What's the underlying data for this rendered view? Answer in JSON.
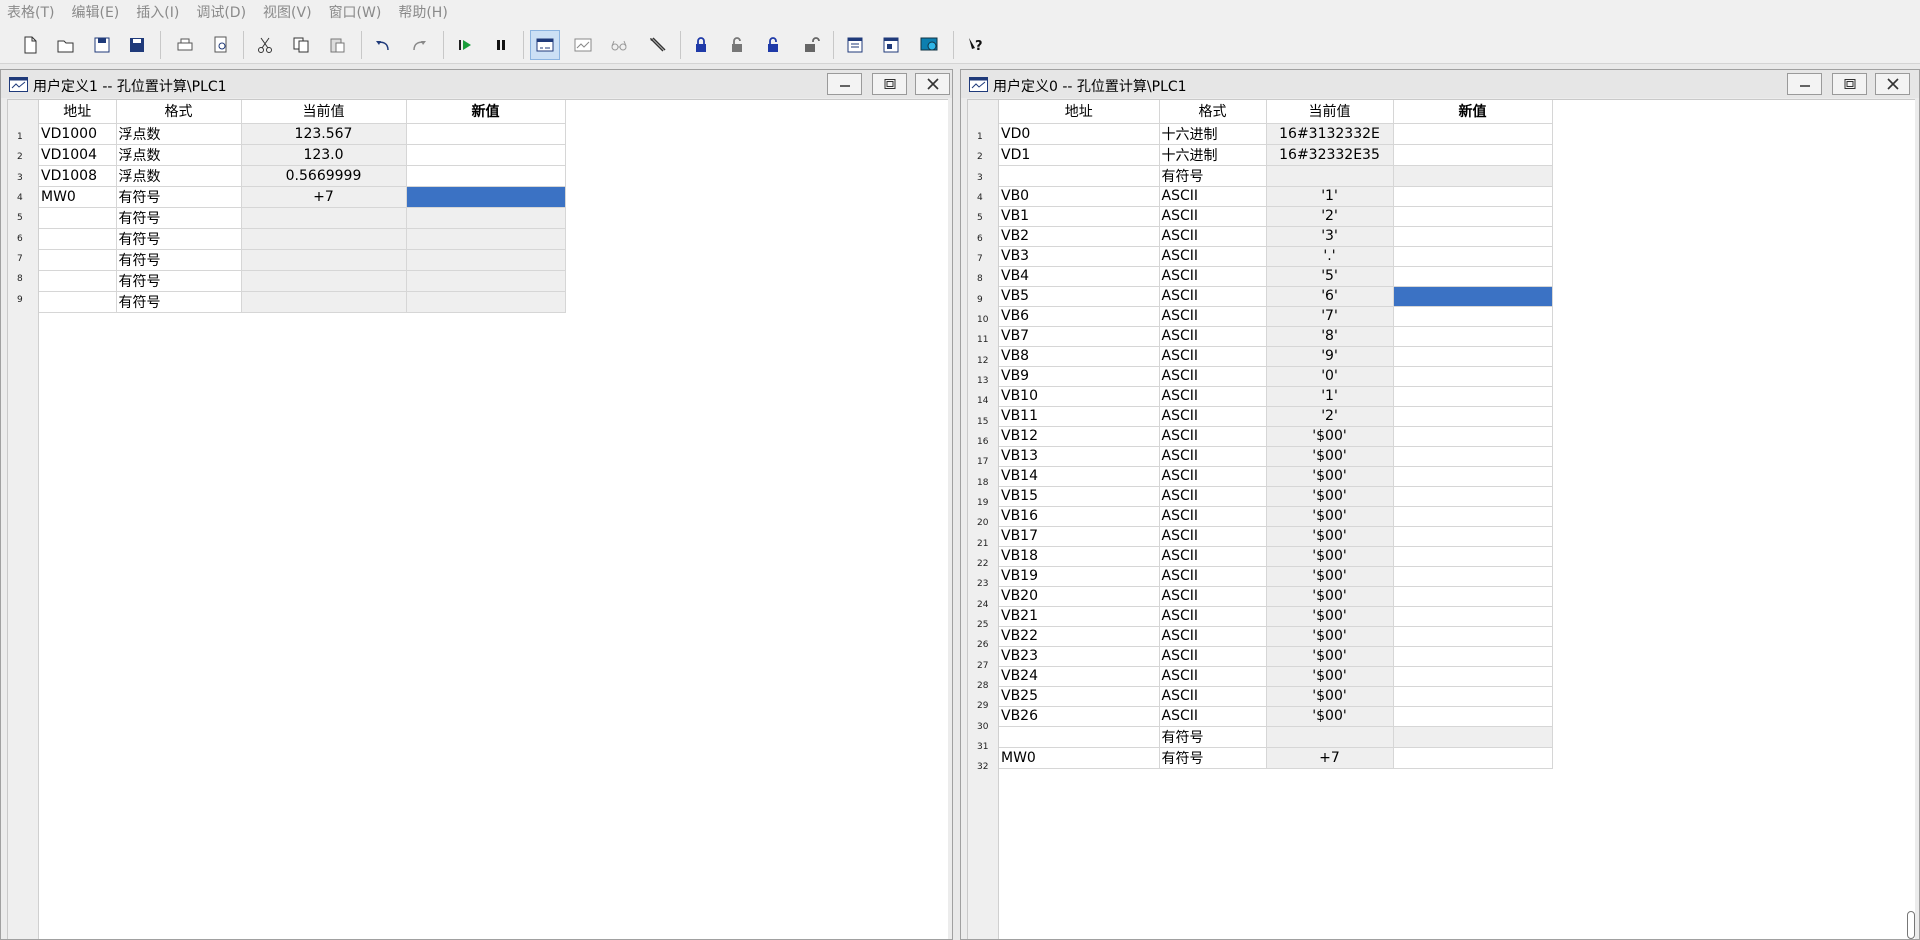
{
  "menu": [
    "表格(T)",
    "编辑(E)",
    "插入(I)",
    "调试(D)",
    "视图(V)",
    "窗口(W)",
    "帮助(H)"
  ],
  "toolbar_icons": [
    "new-file-icon",
    "open-folder-icon",
    "save-icon",
    "save-all-icon",
    "print-icon",
    "print-preview-icon",
    "cut-icon",
    "copy-icon",
    "paste-icon",
    "undo-icon",
    "redo-icon",
    "run-icon",
    "pause-icon",
    "status-chart-icon",
    "chart-trend-icon",
    "glasses-icon",
    "pencil-icon",
    "lock-icon",
    "unlock-icon",
    "force-lock-icon",
    "unforce-icon",
    "read-all-icon",
    "write-all-icon",
    "monitor-icon",
    "help-icon"
  ],
  "left": {
    "title": "用户定义1 -- 孔位置计算\\PLC1",
    "headers": [
      "地址",
      "格式",
      "当前值",
      "新值"
    ],
    "rows": [
      {
        "n": "1",
        "addr": "VD1000",
        "fmt": "浮点数",
        "cur": "123.567",
        "new": ""
      },
      {
        "n": "2",
        "addr": "VD1004",
        "fmt": "浮点数",
        "cur": "123.0",
        "new": ""
      },
      {
        "n": "3",
        "addr": "VD1008",
        "fmt": "浮点数",
        "cur": "0.5669999",
        "new": ""
      },
      {
        "n": "4",
        "addr": "MW0",
        "fmt": "有符号",
        "cur": "+7",
        "new": ""
      },
      {
        "n": "5",
        "addr": "",
        "fmt": "有符号",
        "cur": "",
        "new": ""
      },
      {
        "n": "6",
        "addr": "",
        "fmt": "有符号",
        "cur": "",
        "new": ""
      },
      {
        "n": "7",
        "addr": "",
        "fmt": "有符号",
        "cur": "",
        "new": ""
      },
      {
        "n": "8",
        "addr": "",
        "fmt": "有符号",
        "cur": "",
        "new": ""
      },
      {
        "n": "9",
        "addr": "",
        "fmt": "有符号",
        "cur": "",
        "new": ""
      }
    ]
  },
  "right": {
    "title": "用户定义0 -- 孔位置计算\\PLC1",
    "headers": [
      "地址",
      "格式",
      "当前值",
      "新值"
    ],
    "rows": [
      {
        "n": "1",
        "addr": "VD0",
        "fmt": "十六进制",
        "cur": "16#3132332E",
        "new": ""
      },
      {
        "n": "2",
        "addr": "VD1",
        "fmt": "十六进制",
        "cur": "16#32332E35",
        "new": ""
      },
      {
        "n": "3",
        "addr": "",
        "fmt": "有符号",
        "cur": "",
        "new": ""
      },
      {
        "n": "4",
        "addr": "VB0",
        "fmt": "ASCII",
        "cur": "'1'",
        "new": ""
      },
      {
        "n": "5",
        "addr": "VB1",
        "fmt": "ASCII",
        "cur": "'2'",
        "new": ""
      },
      {
        "n": "6",
        "addr": "VB2",
        "fmt": "ASCII",
        "cur": "'3'",
        "new": ""
      },
      {
        "n": "7",
        "addr": "VB3",
        "fmt": "ASCII",
        "cur": "'.'",
        "new": ""
      },
      {
        "n": "8",
        "addr": "VB4",
        "fmt": "ASCII",
        "cur": "'5'",
        "new": ""
      },
      {
        "n": "9",
        "addr": "VB5",
        "fmt": "ASCII",
        "cur": "'6'",
        "new": ""
      },
      {
        "n": "10",
        "addr": "VB6",
        "fmt": "ASCII",
        "cur": "'7'",
        "new": ""
      },
      {
        "n": "11",
        "addr": "VB7",
        "fmt": "ASCII",
        "cur": "'8'",
        "new": ""
      },
      {
        "n": "12",
        "addr": "VB8",
        "fmt": "ASCII",
        "cur": "'9'",
        "new": ""
      },
      {
        "n": "13",
        "addr": "VB9",
        "fmt": "ASCII",
        "cur": "'0'",
        "new": ""
      },
      {
        "n": "14",
        "addr": "VB10",
        "fmt": "ASCII",
        "cur": "'1'",
        "new": ""
      },
      {
        "n": "15",
        "addr": "VB11",
        "fmt": "ASCII",
        "cur": "'2'",
        "new": ""
      },
      {
        "n": "16",
        "addr": "VB12",
        "fmt": "ASCII",
        "cur": "'$00'",
        "new": ""
      },
      {
        "n": "17",
        "addr": "VB13",
        "fmt": "ASCII",
        "cur": "'$00'",
        "new": ""
      },
      {
        "n": "18",
        "addr": "VB14",
        "fmt": "ASCII",
        "cur": "'$00'",
        "new": ""
      },
      {
        "n": "19",
        "addr": "VB15",
        "fmt": "ASCII",
        "cur": "'$00'",
        "new": ""
      },
      {
        "n": "20",
        "addr": "VB16",
        "fmt": "ASCII",
        "cur": "'$00'",
        "new": ""
      },
      {
        "n": "21",
        "addr": "VB17",
        "fmt": "ASCII",
        "cur": "'$00'",
        "new": ""
      },
      {
        "n": "22",
        "addr": "VB18",
        "fmt": "ASCII",
        "cur": "'$00'",
        "new": ""
      },
      {
        "n": "23",
        "addr": "VB19",
        "fmt": "ASCII",
        "cur": "'$00'",
        "new": ""
      },
      {
        "n": "24",
        "addr": "VB20",
        "fmt": "ASCII",
        "cur": "'$00'",
        "new": ""
      },
      {
        "n": "25",
        "addr": "VB21",
        "fmt": "ASCII",
        "cur": "'$00'",
        "new": ""
      },
      {
        "n": "26",
        "addr": "VB22",
        "fmt": "ASCII",
        "cur": "'$00'",
        "new": ""
      },
      {
        "n": "27",
        "addr": "VB23",
        "fmt": "ASCII",
        "cur": "'$00'",
        "new": ""
      },
      {
        "n": "28",
        "addr": "VB24",
        "fmt": "ASCII",
        "cur": "'$00'",
        "new": ""
      },
      {
        "n": "29",
        "addr": "VB25",
        "fmt": "ASCII",
        "cur": "'$00'",
        "new": ""
      },
      {
        "n": "30",
        "addr": "VB26",
        "fmt": "ASCII",
        "cur": "'$00'",
        "new": ""
      },
      {
        "n": "31",
        "addr": "",
        "fmt": "有符号",
        "cur": "",
        "new": ""
      },
      {
        "n": "32",
        "addr": "MW0",
        "fmt": "有符号",
        "cur": "+7",
        "new": ""
      }
    ]
  },
  "colors": {
    "selection": "#3b72c4",
    "value_cell": "#efefef"
  }
}
